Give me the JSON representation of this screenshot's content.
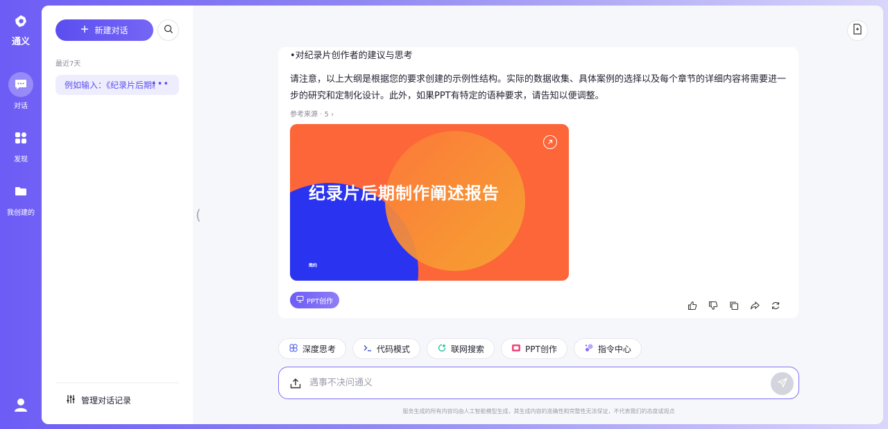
{
  "app": {
    "logo_text": "通义"
  },
  "rail": {
    "items": [
      {
        "label": "对话",
        "icon": "chat-icon",
        "active": true
      },
      {
        "label": "发现",
        "icon": "grid-icon",
        "active": false
      },
      {
        "label": "我创建的",
        "icon": "folder-icon",
        "active": false
      }
    ]
  },
  "sidebar": {
    "new_chat_label": "新建对话",
    "section_label": "最近7天",
    "conversations": [
      {
        "title": "例如输入：《纪录片后期制作阐述报告》"
      }
    ],
    "manage_label": "管理对话记录"
  },
  "message": {
    "bullet": "•对纪录片创作者的建议与思考",
    "paragraph": "请注意，以上大纲是根据您的要求创建的示例性结构。实际的数据收集、具体案例的选择以及每个章节的详细内容将需要进一步的研究和定制化设计。此外，如果PPT有特定的语种要求，请告知以便调整。",
    "refs_label": "参考来源 · 5",
    "ppt": {
      "title": "纪录片后期制作阐述报告",
      "tag": "简约",
      "badge_label": "PPT创作"
    }
  },
  "chips": [
    {
      "label": "深度思考",
      "icon": "think-icon",
      "color": "#5b6cf0"
    },
    {
      "label": "代码模式",
      "icon": "code-icon",
      "color": "#3a4ed0"
    },
    {
      "label": "联网搜索",
      "icon": "web-search-icon",
      "color": "#2bbfa4"
    },
    {
      "label": "PPT创作",
      "icon": "ppt-icon",
      "color": "#f0457a"
    },
    {
      "label": "指令中心",
      "icon": "command-icon",
      "color": "#8a6cf5"
    }
  ],
  "input": {
    "placeholder": "遇事不决问通义"
  },
  "footer": {
    "disclaimer": "服务生成的所有内容均由人工智能模型生成，其生成内容的准确性和完整性无法保证，不代表我们的态度或观点"
  },
  "colors": {
    "accent": "#5b4ef0",
    "ppt_orange": "#fc6638",
    "ppt_blue": "#2a34f0"
  }
}
